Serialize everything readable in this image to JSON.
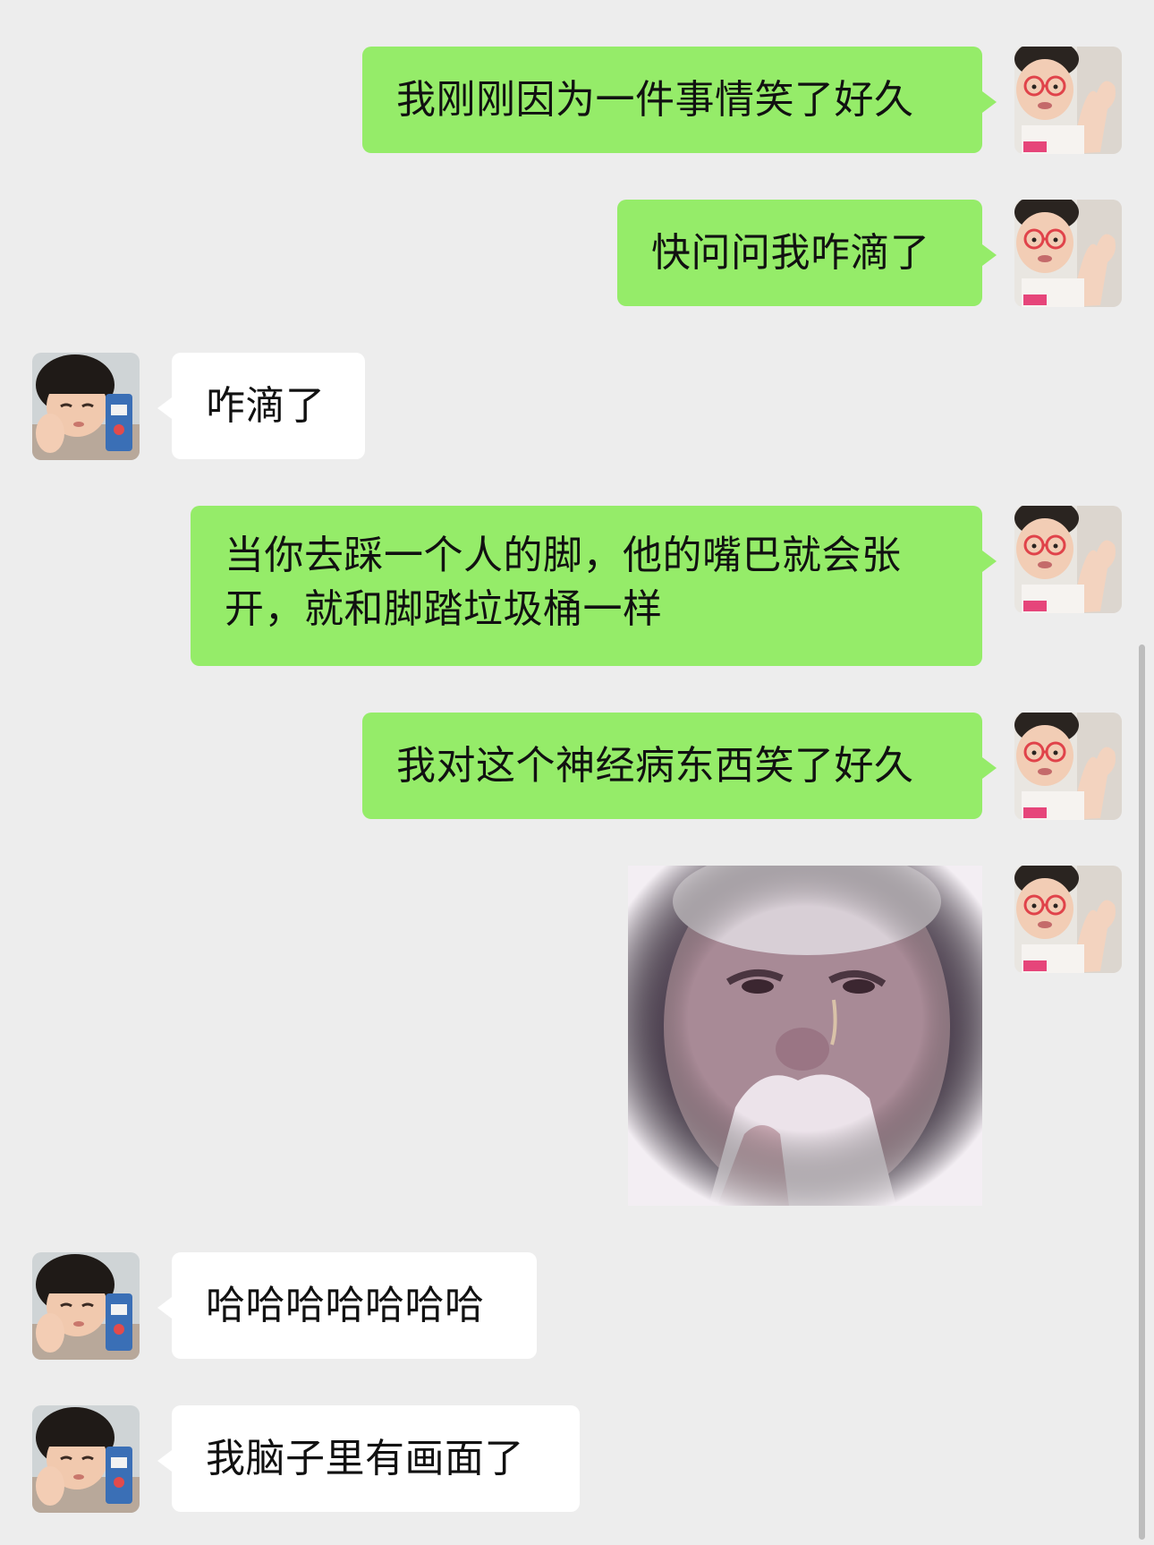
{
  "chat": {
    "messages": [
      {
        "from": "me",
        "type": "text",
        "text": "我刚刚因为一件事情笑了好久"
      },
      {
        "from": "me",
        "type": "text",
        "text": "快问问我咋滴了"
      },
      {
        "from": "them",
        "type": "text",
        "text": "咋滴了"
      },
      {
        "from": "me",
        "type": "text",
        "text": "当你去踩一个人的脚，他的嘴巴就会张开，就和脚踏垃圾桶一样"
      },
      {
        "from": "me",
        "type": "text",
        "text": "我对这个神经病东西笑了好久"
      },
      {
        "from": "me",
        "type": "sticker",
        "icon": "crying-man-sticker"
      },
      {
        "from": "them",
        "type": "text",
        "text": "哈哈哈哈哈哈哈"
      },
      {
        "from": "them",
        "type": "text",
        "text": "我脑子里有画面了"
      }
    ]
  },
  "colors": {
    "background": "#ededed",
    "my_bubble": "#95ec69",
    "their_bubble": "#ffffff"
  },
  "icons": {
    "my_avatar": "girl-with-glasses-flexing-avatar",
    "their_avatar": "girl-resting-cheek-avatar"
  }
}
